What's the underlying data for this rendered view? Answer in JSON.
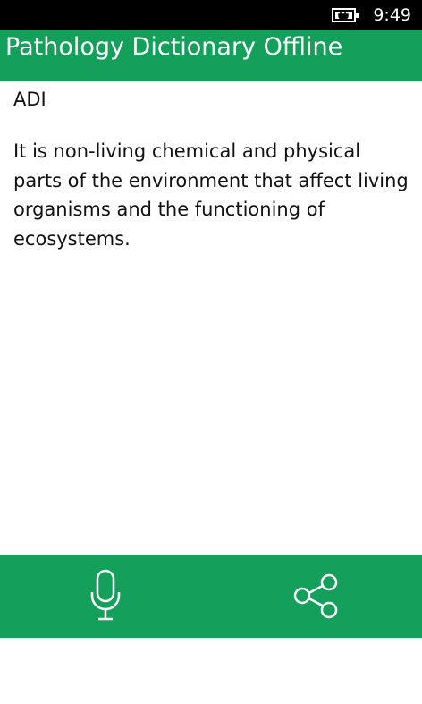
{
  "status_bar": {
    "time": "9:49",
    "battery_icon": "battery-charging-icon"
  },
  "header": {
    "title": "Pathology Dictionary Offline"
  },
  "entry": {
    "term": "ADI",
    "definition": "It is non-living chemical and physical parts of the environment that affect living organisms and the functioning of ecosystems."
  },
  "app_bar": {
    "buttons": [
      {
        "icon": "microphone-icon"
      },
      {
        "icon": "share-icon"
      }
    ]
  },
  "colors": {
    "accent": "#14a05a",
    "status_bar": "#000000",
    "background": "#ffffff",
    "text": "#111111"
  }
}
